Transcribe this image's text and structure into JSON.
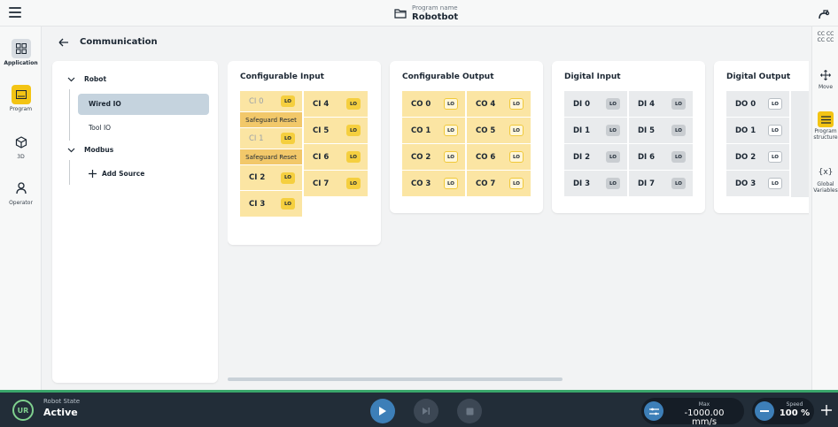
{
  "topbar": {
    "program_label": "Program name",
    "program_name": "Robotbot"
  },
  "left_rail": {
    "items": [
      {
        "label": "Application",
        "icon": "grid-icon"
      },
      {
        "label": "Program",
        "icon": "program-icon"
      },
      {
        "label": "3D",
        "icon": "cube-icon"
      },
      {
        "label": "Operator",
        "icon": "person-icon"
      }
    ]
  },
  "right_rail": {
    "items": [
      {
        "label": "CC CC\nCC CC",
        "icon": "cc-icon"
      },
      {
        "label": "Move",
        "icon": "move-icon"
      },
      {
        "label": "Program structure",
        "icon": "list-icon"
      },
      {
        "label": "Global Variables",
        "icon": "{x}"
      }
    ]
  },
  "header": {
    "title": "Communication"
  },
  "tree": {
    "robot": "Robot",
    "wired_io": "Wired IO",
    "tool_io": "Tool IO",
    "modbus": "Modbus",
    "add_source": "Add Source"
  },
  "cards": {
    "configurable_input": {
      "title": "Configurable Input",
      "col1": [
        {
          "name": "CI 0",
          "lo": "LO"
        },
        {
          "safeguard": "Safeguard Reset"
        },
        {
          "name": "CI 1",
          "lo": "LO"
        },
        {
          "safeguard": "Safeguard Reset"
        },
        {
          "name": "CI 2",
          "lo": "LO"
        },
        {
          "name": "CI 3",
          "lo": "LO"
        }
      ],
      "col2": [
        {
          "name": "CI 4",
          "lo": "LO"
        },
        {
          "name": "CI 5",
          "lo": "LO"
        },
        {
          "name": "CI 6",
          "lo": "LO"
        },
        {
          "name": "CI 7",
          "lo": "LO"
        }
      ]
    },
    "configurable_output": {
      "title": "Configurable Output",
      "col1": [
        "CO 0",
        "CO 1",
        "CO 2",
        "CO 3"
      ],
      "col2": [
        "CO 4",
        "CO 5",
        "CO 6",
        "CO 7"
      ],
      "lo": "LO"
    },
    "digital_input": {
      "title": "Digital Input",
      "col1": [
        "DI 0",
        "DI 1",
        "DI 2",
        "DI 3"
      ],
      "col2": [
        "DI 4",
        "DI 5",
        "DI 6",
        "DI 7"
      ],
      "lo": "LO"
    },
    "digital_output": {
      "title": "Digital Output",
      "col1": [
        "DO 0",
        "DO 1",
        "DO 2",
        "DO 3"
      ],
      "lo": "LO"
    }
  },
  "bottombar": {
    "logo": "UR",
    "robot_state_label": "Robot State",
    "robot_state_value": "Active",
    "max_label": "Max",
    "max_value": "-1000.00 mm/s",
    "speed_label": "Speed",
    "speed_value": "100 %"
  },
  "colors": {
    "accent_yellow": "#f3c414",
    "io_yellow": "#fbe5a3",
    "io_grey": "#e9ebed",
    "bottom_bar": "#222d38",
    "active_green": "#3aa66b",
    "play_blue": "#3d7fb8"
  }
}
